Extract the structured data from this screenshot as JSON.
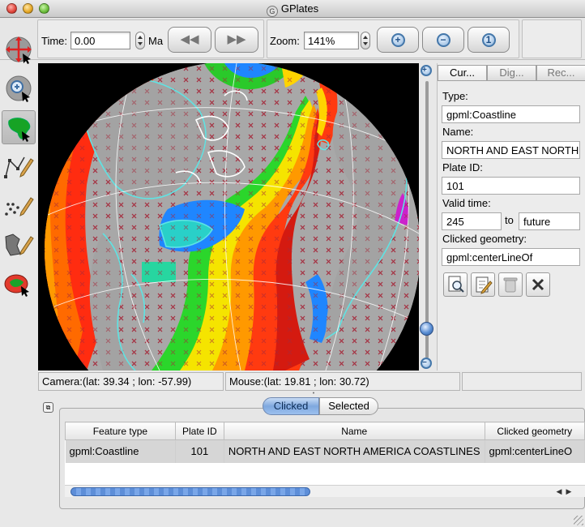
{
  "window": {
    "title": "GPlates",
    "logo_glyph": "G"
  },
  "toolbar": {
    "time_label": "Time:",
    "time_value": "0.00",
    "time_unit": "Ma",
    "rewind_glyph": "◀◀",
    "forward_glyph": "▶▶",
    "zoom_label": "Zoom:",
    "zoom_value": "141%",
    "zoom_in_glyph": "+",
    "zoom_out_glyph": "−",
    "zoom_reset_glyph": "1"
  },
  "tools": [
    {
      "name": "drag-globe"
    },
    {
      "name": "zoom-globe"
    },
    {
      "name": "click-geometry",
      "active": true
    },
    {
      "name": "digitise-polyline"
    },
    {
      "name": "digitise-multipoint"
    },
    {
      "name": "digitise-polygon"
    },
    {
      "name": "move-vertex"
    }
  ],
  "panel": {
    "tabs": [
      {
        "label": "Cur...",
        "active": true
      },
      {
        "label": "Dig..."
      },
      {
        "label": "Rec..."
      }
    ],
    "type_label": "Type:",
    "type_value": "gpml:Coastline",
    "name_label": "Name:",
    "name_value": "NORTH AND EAST NORTH",
    "plate_label": "Plate ID:",
    "plate_value": "101",
    "valid_label": "Valid time:",
    "valid_from": "245",
    "valid_to_label": "to",
    "valid_to": "future",
    "geometry_label": "Clicked geometry:",
    "geometry_value": "gpml:centerLineOf",
    "buttons": [
      "query-icon",
      "edit-icon",
      "trash-icon",
      "clear-icon"
    ]
  },
  "status": {
    "camera": "Camera:(lat: 39.34 ; lon: -57.99)",
    "mouse": "Mouse:(lat: 19.81 ; lon: 30.72)"
  },
  "bottom": {
    "segments": [
      "Clicked",
      "Selected"
    ],
    "columns": [
      "Feature type",
      "Plate ID",
      "Name",
      "Clicked geometry"
    ],
    "rows": [
      {
        "type": "gpml:Coastline",
        "plate": "101",
        "name": "NORTH AND EAST NORTH AMERICA COASTLINES",
        "geometry": "gpml:centerLineO"
      }
    ]
  },
  "colors": {
    "ocean_black": "#000000",
    "land_grey": "#a3a3a3",
    "coastline_cyan": "#5fe3e3",
    "ridge_red": "#e0221b",
    "age_orange": "#ff8a00",
    "age_yellow": "#ffd800",
    "age_green": "#3fd62a",
    "age_blue": "#2a7df2",
    "accent_blue": "#7fa8de"
  }
}
